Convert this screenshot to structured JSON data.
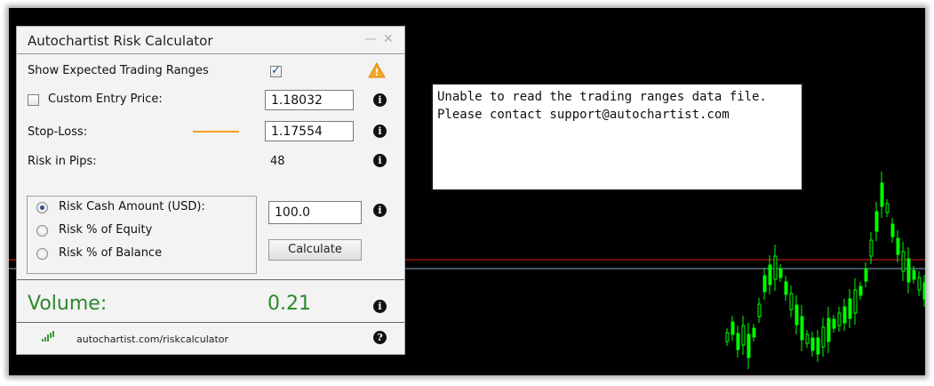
{
  "panel": {
    "title": "Autochartist Risk Calculator",
    "minimize": "—",
    "close": "✕",
    "show_ranges_label": "Show Expected Trading Ranges",
    "show_ranges_checked": true,
    "custom_entry_label": "Custom Entry Price:",
    "custom_entry_checked": false,
    "entry_price": "1.18032",
    "stop_loss_label": "Stop-Loss:",
    "stop_loss_value": "1.17554",
    "risk_pips_label": "Risk in Pips:",
    "risk_pips_value": "48",
    "risk_options": [
      {
        "label": "Risk Cash Amount (USD):",
        "selected": true
      },
      {
        "label": "Risk % of Equity",
        "selected": false
      },
      {
        "label": "Risk % of Balance",
        "selected": false
      }
    ],
    "risk_amount": "100.0",
    "calculate_label": "Calculate",
    "volume_label": "Volume:",
    "volume_value": "0.21",
    "footer_link": "autochartist.com/riskcalculator",
    "info_glyph": "i",
    "help_glyph": "?",
    "warning_glyph": "!"
  },
  "message": {
    "line1": "Unable to read the trading ranges data file.",
    "line2": "Please contact support@autochartist.com"
  },
  "colors": {
    "volume": "#2a8a2a",
    "stop_line": "#f0a020",
    "red_line": "#e02020",
    "blue_line": "#8aa8c8",
    "candles": "#00ff00",
    "warning": "#f5a623"
  },
  "icons": {
    "warning": "warning-icon",
    "info": "info-icon",
    "help": "help-icon",
    "logo": "autochartist-logo-icon"
  }
}
